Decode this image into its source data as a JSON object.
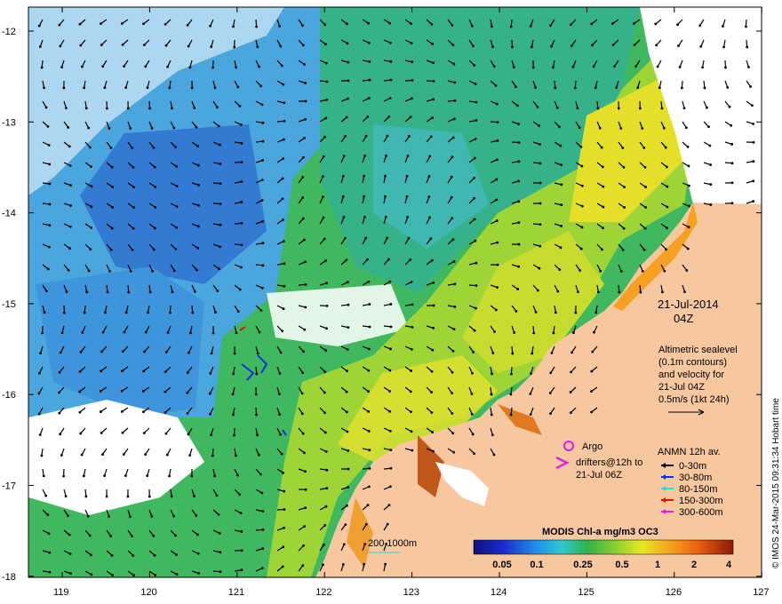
{
  "map": {
    "date": "21-Jul-2014",
    "time": "04Z",
    "lat_ticks": [
      "-12",
      "-13",
      "-14",
      "-15",
      "-16",
      "-17",
      "-18"
    ],
    "lon_ticks": [
      "119",
      "120",
      "121",
      "122",
      "123",
      "124",
      "125",
      "126",
      "127"
    ],
    "altimetry_text": [
      "Altimetric sealevel",
      "(0.1m contours)",
      "and velocity for",
      "21-Jul 04Z",
      "0.5m/s (1kt 24h)"
    ],
    "argo_label": "Argo",
    "drifters_label": [
      "drifters@12h to",
      "21-Jul 06Z"
    ],
    "anmn_title": "ANMN 12h av.",
    "anmn_legend": [
      {
        "label": "0-30m",
        "color": "#000000"
      },
      {
        "label": "30-80m",
        "color": "#1030e0"
      },
      {
        "label": "80-150m",
        "color": "#20e0e0"
      },
      {
        "label": "150-300m",
        "color": "#e01010"
      },
      {
        "label": "300-600m",
        "color": "#e020e0"
      }
    ],
    "isobath_label": "200  1000m",
    "colorbar_title": "MODIS Chl-a mg/m3 OC3",
    "colorbar_ticks": [
      "0.05",
      "0.1",
      "0.25",
      "0.5",
      "1",
      "2",
      "4"
    ],
    "credit": "© IMOS 24-Mar-2015 09:31:34 Hobart time",
    "colors": {
      "land": "#f7c7a0",
      "ocean_green": "#39b65a",
      "ocean_blue": "#3aa0e0",
      "argo": "#e020e0",
      "drifter": "#e020e0",
      "isobath": "#30d0d0"
    }
  }
}
